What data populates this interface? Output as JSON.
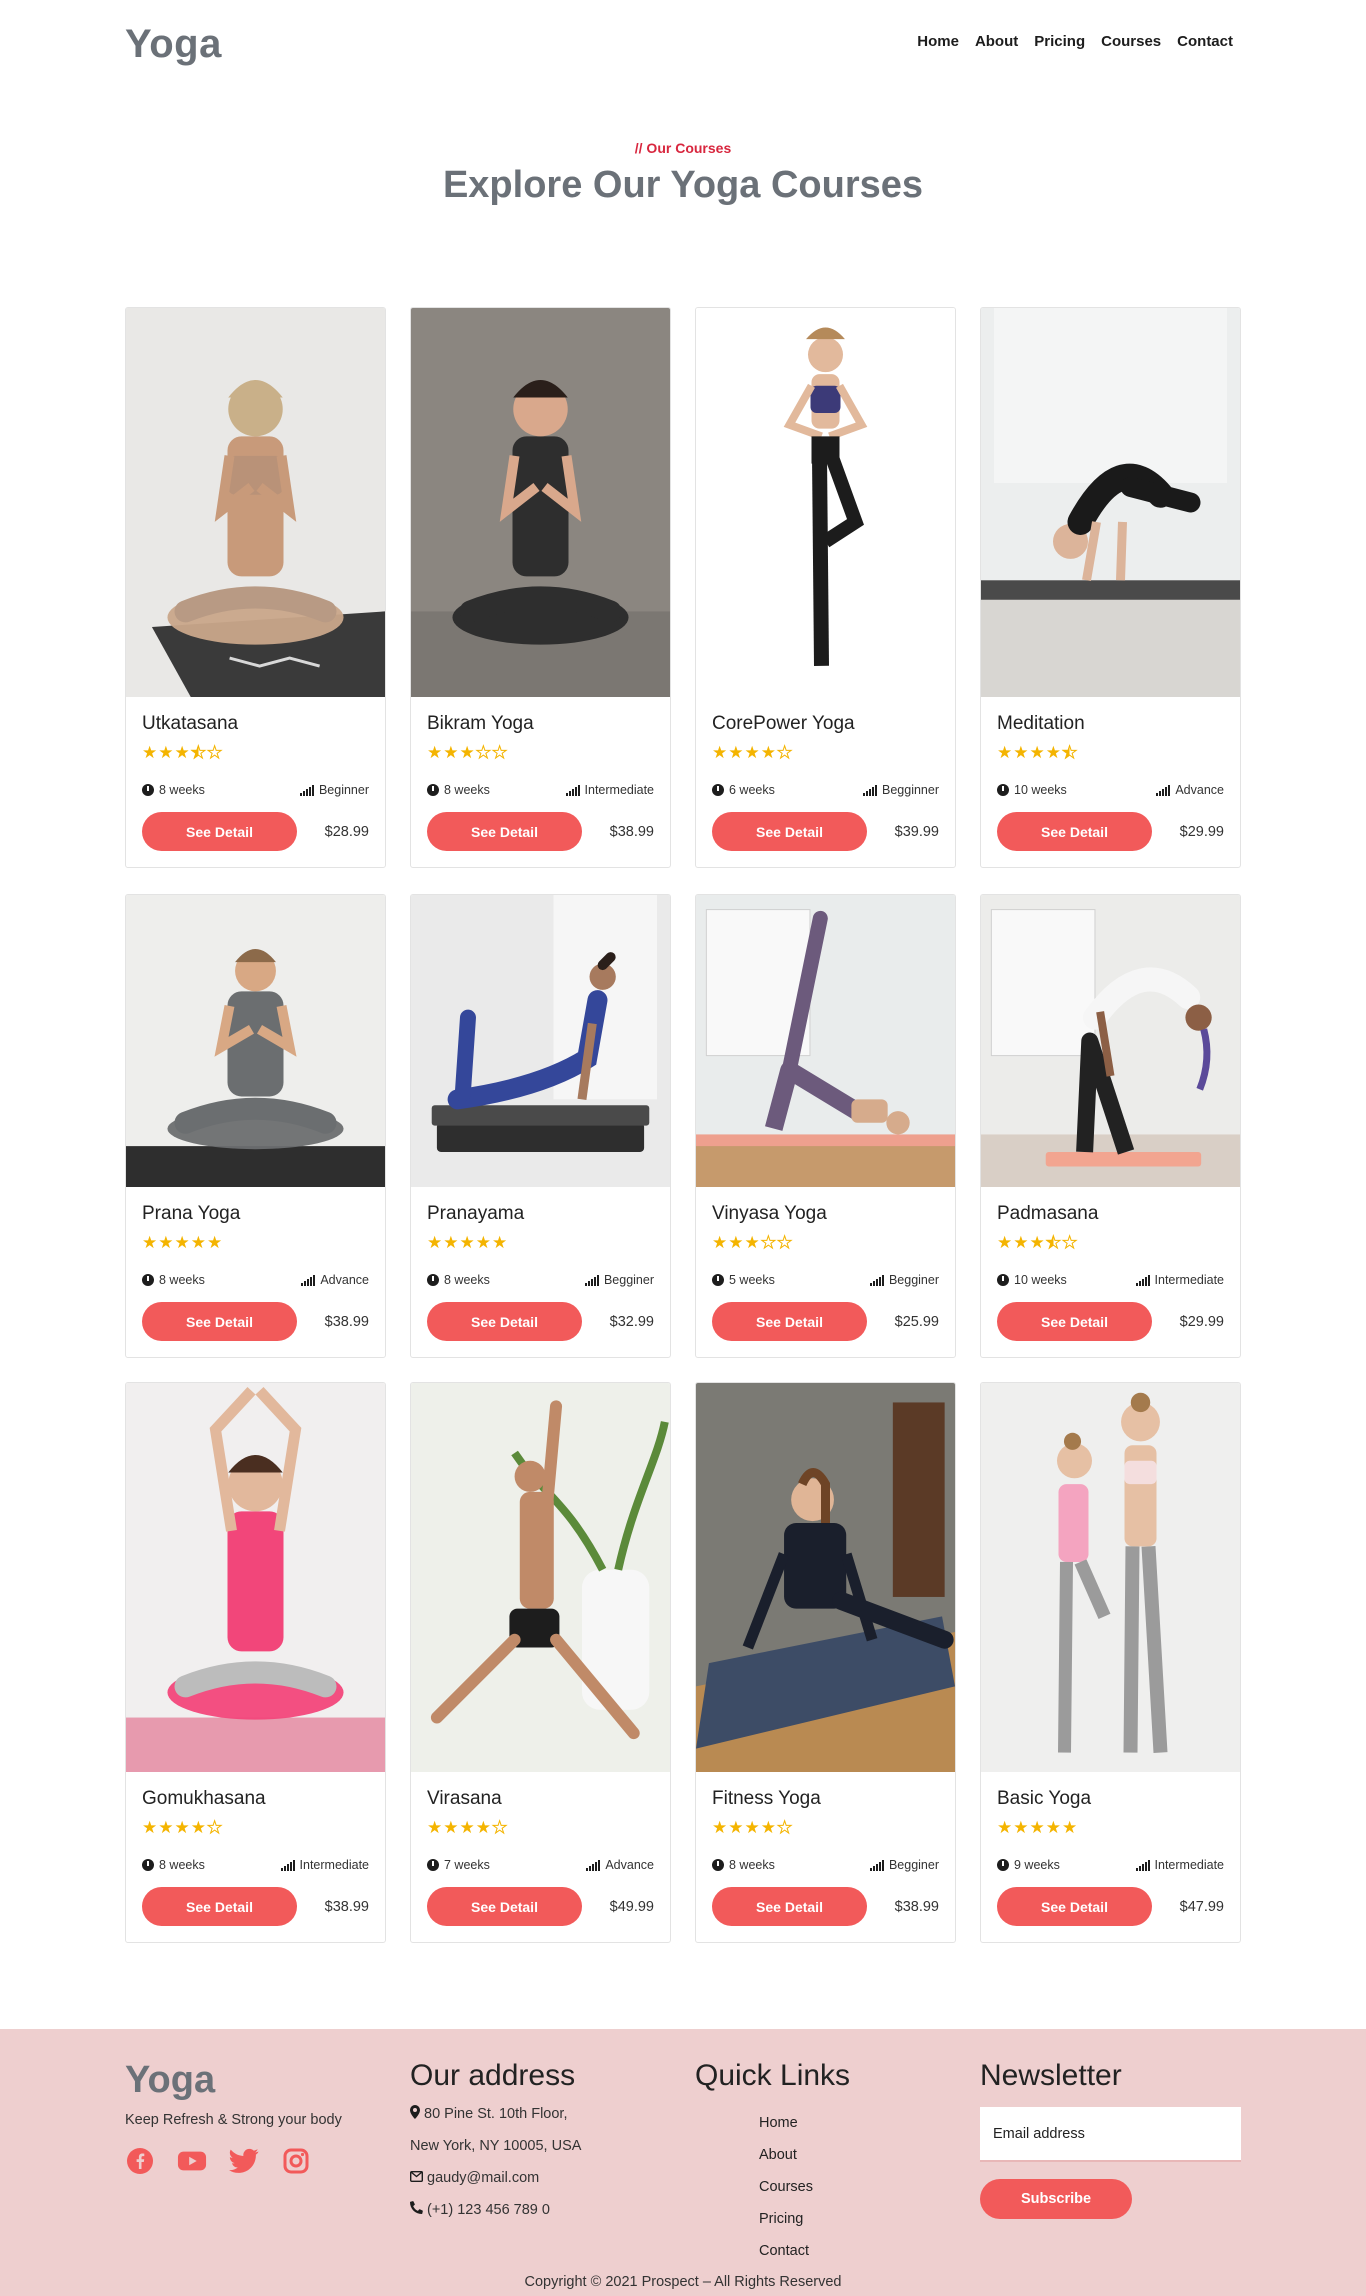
{
  "nav": {
    "brand": "Yoga",
    "links": [
      "Home",
      "About",
      "Pricing",
      "Courses",
      "Contact"
    ]
  },
  "section": {
    "kicker": "// Our Courses",
    "title": "Explore Our Yoga Courses"
  },
  "colors": {
    "accent": "#f25a5a",
    "kicker": "#d8263e",
    "star": "#f4b400",
    "footer_bg": "#eecfcf",
    "brand": "#6b7178"
  },
  "courses": [
    {
      "name": "Utkatasana",
      "rating": 3.5,
      "duration": "8 weeks",
      "level": "Beginner",
      "price": "$28.99",
      "button": "See Detail"
    },
    {
      "name": "Bikram Yoga",
      "rating": 3,
      "duration": "8 weeks",
      "level": "Intermediate",
      "price": "$38.99",
      "button": "See Detail"
    },
    {
      "name": "CorePower Yoga",
      "rating": 4,
      "duration": "6 weeks",
      "level": "Begginner",
      "price": "$39.99",
      "button": "See Detail"
    },
    {
      "name": "Meditation",
      "rating": 4.5,
      "duration": "10 weeks",
      "level": "Advance",
      "price": "$29.99",
      "button": "See Detail"
    },
    {
      "name": "Prana Yoga",
      "rating": 5,
      "duration": "8 weeks",
      "level": "Advance",
      "price": "$38.99",
      "button": "See Detail"
    },
    {
      "name": "Pranayama",
      "rating": 5,
      "duration": "8 weeks",
      "level": "Begginer",
      "price": "$32.99",
      "button": "See Detail"
    },
    {
      "name": "Vinyasa Yoga",
      "rating": 3,
      "duration": "5 weeks",
      "level": "Begginer",
      "price": "$25.99",
      "button": "See Detail"
    },
    {
      "name": "Padmasana",
      "rating": 3.5,
      "duration": "10 weeks",
      "level": "Intermediate",
      "price": "$29.99",
      "button": "See Detail"
    },
    {
      "name": "Gomukhasana",
      "rating": 4,
      "duration": "8 weeks",
      "level": "Intermediate",
      "price": "$38.99",
      "button": "See Detail"
    },
    {
      "name": "Virasana",
      "rating": 4,
      "duration": "7 weeks",
      "level": "Advance",
      "price": "$49.99",
      "button": "See Detail"
    },
    {
      "name": "Fitness Yoga",
      "rating": 4,
      "duration": "8 weeks",
      "level": "Begginer",
      "price": "$38.99",
      "button": "See Detail"
    },
    {
      "name": "Basic Yoga",
      "rating": 5,
      "duration": "9 weeks",
      "level": "Intermediate",
      "price": "$47.99",
      "button": "See Detail"
    }
  ],
  "footer": {
    "brand": "Yoga",
    "tagline": "Keep Refresh & Strong your body",
    "social_icons": [
      "facebook-icon",
      "youtube-icon",
      "twitter-icon",
      "instagram-icon"
    ],
    "address_title": "Our address",
    "address_line1": "80 Pine St. 10th Floor,",
    "address_line2": "New York, NY 10005, USA",
    "email": "gaudy@mail.com",
    "phone": "(+1) 123 456 789 0",
    "quick_title": "Quick Links",
    "quick_links": [
      "Home",
      "About",
      "Courses",
      "Pricing",
      "Contact"
    ],
    "newsletter_title": "Newsletter",
    "email_placeholder": "Email address",
    "subscribe": "Subscribe",
    "copyright": "Copyright © 2021 Prospect – All Rights Reserved"
  }
}
